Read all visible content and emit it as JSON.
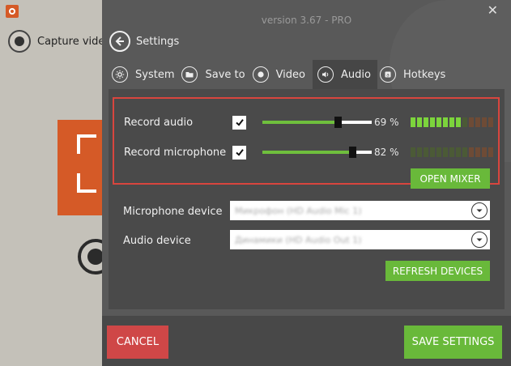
{
  "background_app": {
    "capture_label": "Capture video"
  },
  "header": {
    "version": "version 3.67 - PRO",
    "close_glyph": "✕",
    "title": "Settings"
  },
  "tabs": [
    {
      "label": "System",
      "icon": "gear-icon"
    },
    {
      "label": "Save to",
      "icon": "folder-icon"
    },
    {
      "label": "Video",
      "icon": "record-icon"
    },
    {
      "label": "Audio",
      "icon": "speaker-icon",
      "active": true
    },
    {
      "label": "Hotkeys",
      "icon": "keyboard-icon"
    }
  ],
  "audio": {
    "record_audio": {
      "label": "Record audio",
      "checked": true,
      "level": 69,
      "level_text": "69 %",
      "meter_on": 8,
      "meter_total": 13
    },
    "record_microphone": {
      "label": "Record microphone",
      "checked": true,
      "level": 82,
      "level_text": "82 %",
      "meter_on": 0,
      "meter_total": 13
    },
    "open_mixer_label": "OPEN MIXER"
  },
  "devices": {
    "microphone_label": "Microphone device",
    "microphone_value": "Микрофон (HD Audio Mic 1)",
    "audio_label": "Audio device",
    "audio_value": "Динамики (HD Audio Out 1)",
    "refresh_label": "REFRESH DEVICES"
  },
  "footer": {
    "cancel_label": "CANCEL",
    "save_label": "SAVE SETTINGS"
  },
  "colors": {
    "accent_green": "#69b93a",
    "cancel_red": "#cf4747",
    "highlight_border": "#d8453e",
    "panel_bg": "#595959"
  }
}
